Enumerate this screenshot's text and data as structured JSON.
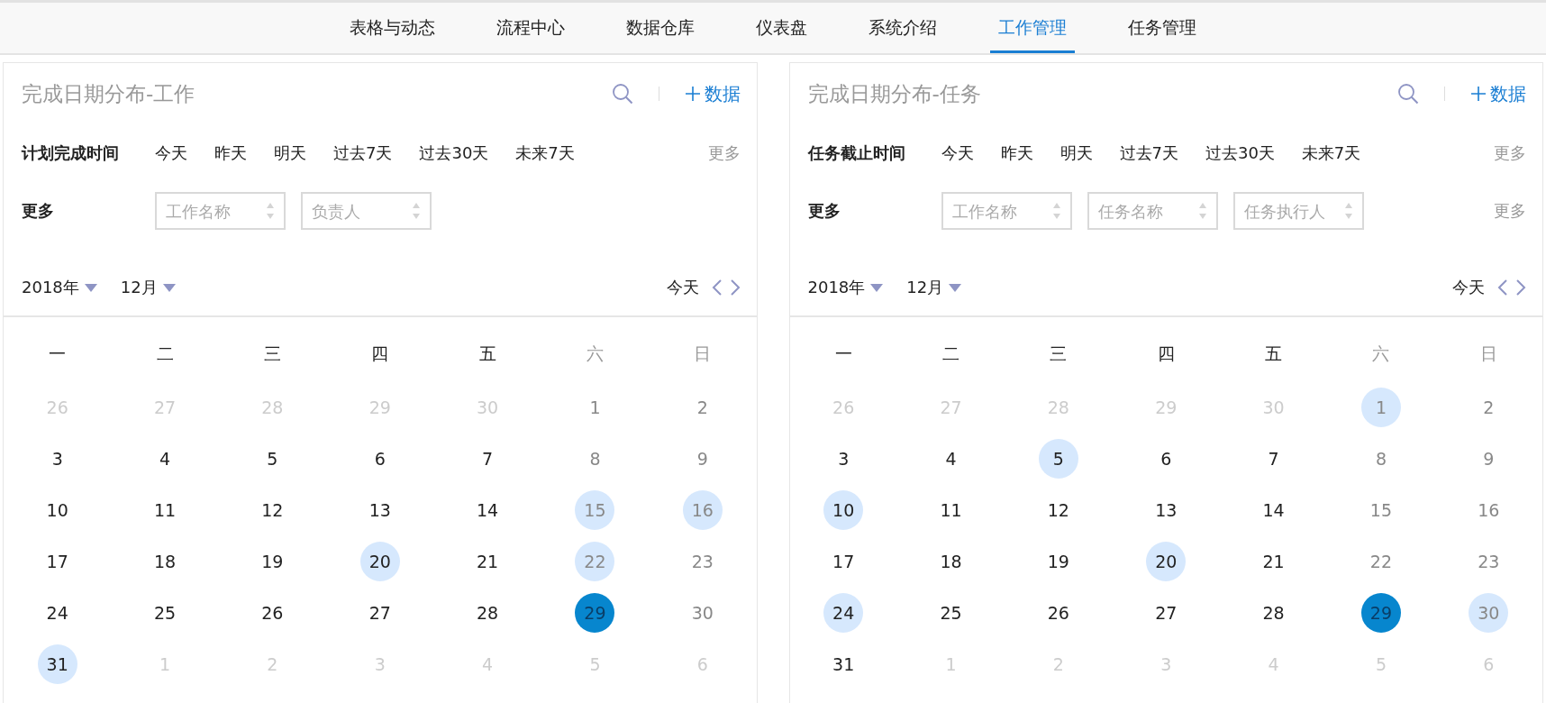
{
  "nav": {
    "tabs": [
      {
        "label": "表格与动态",
        "selected": false
      },
      {
        "label": "流程中心",
        "selected": false
      },
      {
        "label": "数据仓库",
        "selected": false
      },
      {
        "label": "仪表盘",
        "selected": false
      },
      {
        "label": "系统介绍",
        "selected": false
      },
      {
        "label": "工作管理",
        "selected": true
      },
      {
        "label": "任务管理",
        "selected": false
      }
    ]
  },
  "panels": [
    {
      "title": "完成日期分布-工作",
      "add_label": "数据",
      "time_filter": {
        "label": "计划完成时间",
        "options": [
          "今天",
          "昨天",
          "明天",
          "过去7天",
          "过去30天",
          "未来7天"
        ],
        "more": "更多"
      },
      "more_filter": {
        "label": "更多",
        "selects": [
          {
            "placeholder": "工作名称"
          },
          {
            "placeholder": "负责人"
          }
        ]
      },
      "year": "2018年",
      "month": "12月",
      "today": "今天",
      "weekdays": [
        "一",
        "二",
        "三",
        "四",
        "五",
        "六",
        "日"
      ],
      "days": [
        {
          "d": "26",
          "kind": "outside",
          "marked": false,
          "selected": false
        },
        {
          "d": "27",
          "kind": "outside",
          "marked": false,
          "selected": false
        },
        {
          "d": "28",
          "kind": "outside",
          "marked": false,
          "selected": false
        },
        {
          "d": "29",
          "kind": "outside",
          "marked": false,
          "selected": false
        },
        {
          "d": "30",
          "kind": "outside",
          "marked": false,
          "selected": false
        },
        {
          "d": "1",
          "kind": "weekend",
          "marked": false,
          "selected": false
        },
        {
          "d": "2",
          "kind": "weekend",
          "marked": false,
          "selected": false
        },
        {
          "d": "3",
          "kind": "weekday",
          "marked": false,
          "selected": false
        },
        {
          "d": "4",
          "kind": "weekday",
          "marked": false,
          "selected": false
        },
        {
          "d": "5",
          "kind": "weekday",
          "marked": false,
          "selected": false
        },
        {
          "d": "6",
          "kind": "weekday",
          "marked": false,
          "selected": false
        },
        {
          "d": "7",
          "kind": "weekday",
          "marked": false,
          "selected": false
        },
        {
          "d": "8",
          "kind": "weekend",
          "marked": false,
          "selected": false
        },
        {
          "d": "9",
          "kind": "weekend",
          "marked": false,
          "selected": false
        },
        {
          "d": "10",
          "kind": "weekday",
          "marked": false,
          "selected": false
        },
        {
          "d": "11",
          "kind": "weekday",
          "marked": false,
          "selected": false
        },
        {
          "d": "12",
          "kind": "weekday",
          "marked": false,
          "selected": false
        },
        {
          "d": "13",
          "kind": "weekday",
          "marked": false,
          "selected": false
        },
        {
          "d": "14",
          "kind": "weekday",
          "marked": false,
          "selected": false
        },
        {
          "d": "15",
          "kind": "weekend",
          "marked": true,
          "selected": false
        },
        {
          "d": "16",
          "kind": "weekend",
          "marked": true,
          "selected": false
        },
        {
          "d": "17",
          "kind": "weekday",
          "marked": false,
          "selected": false
        },
        {
          "d": "18",
          "kind": "weekday",
          "marked": false,
          "selected": false
        },
        {
          "d": "19",
          "kind": "weekday",
          "marked": false,
          "selected": false
        },
        {
          "d": "20",
          "kind": "weekday",
          "marked": true,
          "selected": false
        },
        {
          "d": "21",
          "kind": "weekday",
          "marked": false,
          "selected": false
        },
        {
          "d": "22",
          "kind": "weekend",
          "marked": true,
          "selected": false
        },
        {
          "d": "23",
          "kind": "weekend",
          "marked": false,
          "selected": false
        },
        {
          "d": "24",
          "kind": "weekday",
          "marked": false,
          "selected": false
        },
        {
          "d": "25",
          "kind": "weekday",
          "marked": false,
          "selected": false
        },
        {
          "d": "26",
          "kind": "weekday",
          "marked": false,
          "selected": false
        },
        {
          "d": "27",
          "kind": "weekday",
          "marked": false,
          "selected": false
        },
        {
          "d": "28",
          "kind": "weekday",
          "marked": false,
          "selected": false
        },
        {
          "d": "29",
          "kind": "weekend",
          "marked": false,
          "selected": true
        },
        {
          "d": "30",
          "kind": "weekend",
          "marked": false,
          "selected": false
        },
        {
          "d": "31",
          "kind": "weekday",
          "marked": true,
          "selected": false
        },
        {
          "d": "1",
          "kind": "outside",
          "marked": false,
          "selected": false
        },
        {
          "d": "2",
          "kind": "outside",
          "marked": false,
          "selected": false
        },
        {
          "d": "3",
          "kind": "outside",
          "marked": false,
          "selected": false
        },
        {
          "d": "4",
          "kind": "outside",
          "marked": false,
          "selected": false
        },
        {
          "d": "5",
          "kind": "outside",
          "marked": false,
          "selected": false
        },
        {
          "d": "6",
          "kind": "outside",
          "marked": false,
          "selected": false
        }
      ]
    },
    {
      "title": "完成日期分布-任务",
      "add_label": "数据",
      "time_filter": {
        "label": "任务截止时间",
        "options": [
          "今天",
          "昨天",
          "明天",
          "过去7天",
          "过去30天",
          "未来7天"
        ],
        "more": "更多"
      },
      "more_filter": {
        "label": "更多",
        "selects": [
          {
            "placeholder": "工作名称"
          },
          {
            "placeholder": "任务名称"
          },
          {
            "placeholder": "任务执行人"
          }
        ],
        "more": "更多"
      },
      "year": "2018年",
      "month": "12月",
      "today": "今天",
      "weekdays": [
        "一",
        "二",
        "三",
        "四",
        "五",
        "六",
        "日"
      ],
      "days": [
        {
          "d": "26",
          "kind": "outside",
          "marked": false,
          "selected": false
        },
        {
          "d": "27",
          "kind": "outside",
          "marked": false,
          "selected": false
        },
        {
          "d": "28",
          "kind": "outside",
          "marked": false,
          "selected": false
        },
        {
          "d": "29",
          "kind": "outside",
          "marked": false,
          "selected": false
        },
        {
          "d": "30",
          "kind": "outside",
          "marked": false,
          "selected": false
        },
        {
          "d": "1",
          "kind": "weekend",
          "marked": true,
          "selected": false
        },
        {
          "d": "2",
          "kind": "weekend",
          "marked": false,
          "selected": false
        },
        {
          "d": "3",
          "kind": "weekday",
          "marked": false,
          "selected": false
        },
        {
          "d": "4",
          "kind": "weekday",
          "marked": false,
          "selected": false
        },
        {
          "d": "5",
          "kind": "weekday",
          "marked": true,
          "selected": false
        },
        {
          "d": "6",
          "kind": "weekday",
          "marked": false,
          "selected": false
        },
        {
          "d": "7",
          "kind": "weekday",
          "marked": false,
          "selected": false
        },
        {
          "d": "8",
          "kind": "weekend",
          "marked": false,
          "selected": false
        },
        {
          "d": "9",
          "kind": "weekend",
          "marked": false,
          "selected": false
        },
        {
          "d": "10",
          "kind": "weekday",
          "marked": true,
          "selected": false
        },
        {
          "d": "11",
          "kind": "weekday",
          "marked": false,
          "selected": false
        },
        {
          "d": "12",
          "kind": "weekday",
          "marked": false,
          "selected": false
        },
        {
          "d": "13",
          "kind": "weekday",
          "marked": false,
          "selected": false
        },
        {
          "d": "14",
          "kind": "weekday",
          "marked": false,
          "selected": false
        },
        {
          "d": "15",
          "kind": "weekend",
          "marked": false,
          "selected": false
        },
        {
          "d": "16",
          "kind": "weekend",
          "marked": false,
          "selected": false
        },
        {
          "d": "17",
          "kind": "weekday",
          "marked": false,
          "selected": false
        },
        {
          "d": "18",
          "kind": "weekday",
          "marked": false,
          "selected": false
        },
        {
          "d": "19",
          "kind": "weekday",
          "marked": false,
          "selected": false
        },
        {
          "d": "20",
          "kind": "weekday",
          "marked": true,
          "selected": false
        },
        {
          "d": "21",
          "kind": "weekday",
          "marked": false,
          "selected": false
        },
        {
          "d": "22",
          "kind": "weekend",
          "marked": false,
          "selected": false
        },
        {
          "d": "23",
          "kind": "weekend",
          "marked": false,
          "selected": false
        },
        {
          "d": "24",
          "kind": "weekday",
          "marked": true,
          "selected": false
        },
        {
          "d": "25",
          "kind": "weekday",
          "marked": false,
          "selected": false
        },
        {
          "d": "26",
          "kind": "weekday",
          "marked": false,
          "selected": false
        },
        {
          "d": "27",
          "kind": "weekday",
          "marked": false,
          "selected": false
        },
        {
          "d": "28",
          "kind": "weekday",
          "marked": false,
          "selected": false
        },
        {
          "d": "29",
          "kind": "weekend",
          "marked": false,
          "selected": true
        },
        {
          "d": "30",
          "kind": "weekend",
          "marked": true,
          "selected": false
        },
        {
          "d": "31",
          "kind": "weekday",
          "marked": false,
          "selected": false
        },
        {
          "d": "1",
          "kind": "outside",
          "marked": false,
          "selected": false
        },
        {
          "d": "2",
          "kind": "outside",
          "marked": false,
          "selected": false
        },
        {
          "d": "3",
          "kind": "outside",
          "marked": false,
          "selected": false
        },
        {
          "d": "4",
          "kind": "outside",
          "marked": false,
          "selected": false
        },
        {
          "d": "5",
          "kind": "outside",
          "marked": false,
          "selected": false
        },
        {
          "d": "6",
          "kind": "outside",
          "marked": false,
          "selected": false
        }
      ]
    }
  ]
}
